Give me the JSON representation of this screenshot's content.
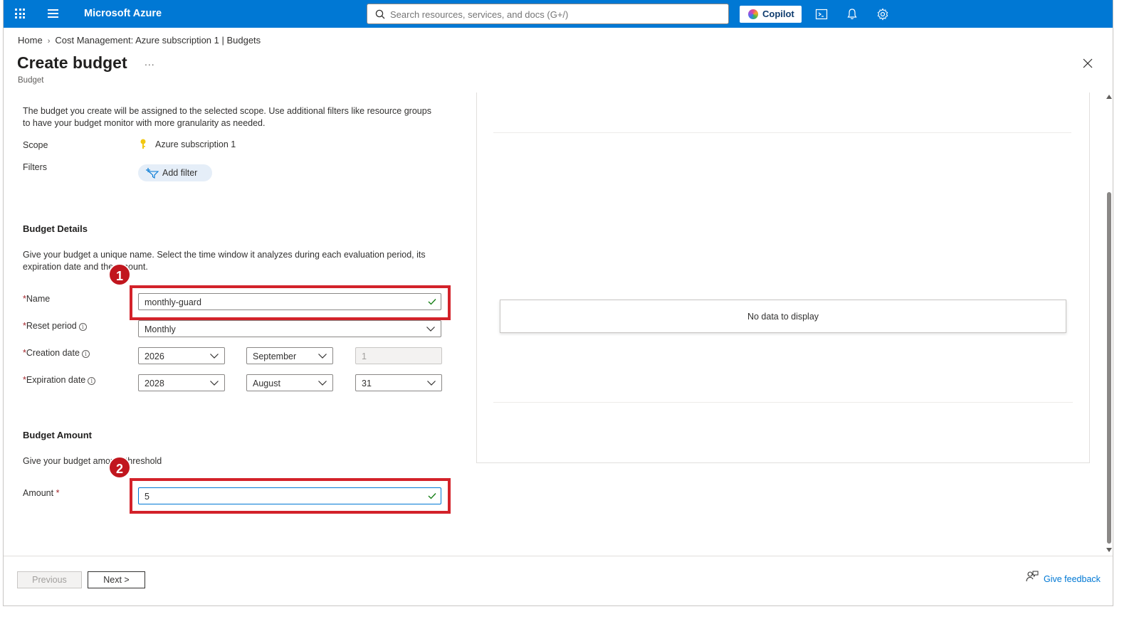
{
  "topbar": {
    "brand": "Microsoft Azure",
    "search_placeholder": "Search resources, services, and docs (G+/)",
    "copilot_label": "Copilot",
    "color": "#0078d4"
  },
  "breadcrumb": {
    "items": [
      "Home",
      "Cost Management: Azure subscription 1 | Budgets"
    ]
  },
  "page": {
    "title": "Create budget",
    "more": "...",
    "subtitle": "Budget"
  },
  "scope_section": {
    "description_line1": "The budget you create will be assigned to the selected scope. Use additional filters like resource groups",
    "description_line2": "to have your budget monitor with more granularity as needed.",
    "scope_label": "Scope",
    "scope_value": "Azure subscription 1",
    "filters_label": "Filters",
    "add_filter_label": "Add filter"
  },
  "budget_details": {
    "heading": "Budget Details",
    "description_line1": "Give your budget a unique name. Select the time window it analyzes during each evaluation period, its",
    "description_line2": "expiration date and the amount.",
    "name_label": "Name",
    "name_value": "monthly-guard",
    "reset_period_label": "Reset period",
    "reset_period_value": "Monthly",
    "creation_date_label": "Creation date",
    "creation_year": "2026",
    "creation_month": "September",
    "creation_day": "1",
    "expiration_date_label": "Expiration date",
    "expiration_year": "2028",
    "expiration_month": "August",
    "expiration_day": "31"
  },
  "budget_amount": {
    "heading": "Budget Amount",
    "description": "Give your budget amount threshold",
    "amount_label": "Amount",
    "amount_value": "5"
  },
  "annotations": {
    "badge1": "1",
    "badge2": "2",
    "highlight_color": "#d3222a"
  },
  "chart_panel": {
    "empty_message": "No data to display"
  },
  "footer": {
    "previous_label": "Previous",
    "next_label": "Next >",
    "feedback_label": "Give feedback"
  }
}
